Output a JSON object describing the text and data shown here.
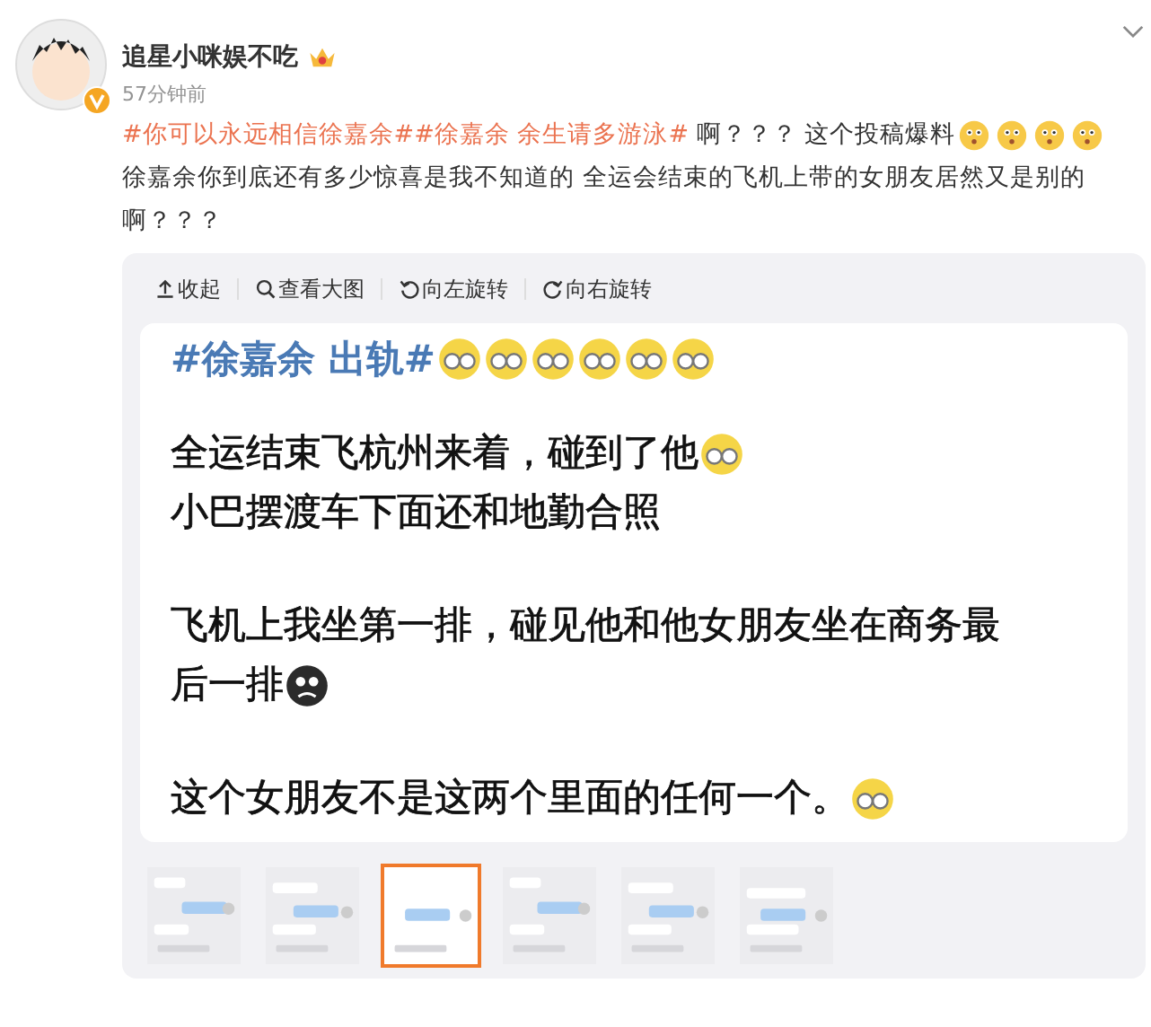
{
  "post": {
    "author": "追星小咪娱不吃",
    "verified": true,
    "time": "57分钟前",
    "lines": [
      [
        {
          "kind": "hashtag",
          "text": "#你可以永远相信徐嘉余#"
        },
        {
          "kind": "hashtag",
          "text": "#徐嘉余 余生请多游泳#"
        },
        {
          "kind": "text",
          "text": " 啊？？？ 这个投稿爆料"
        },
        {
          "kind": "surprised"
        },
        {
          "kind": "surprised"
        },
        {
          "kind": "surprised"
        },
        {
          "kind": "surprised"
        }
      ],
      [
        {
          "kind": "text",
          "text": "徐嘉余你到底还有多少惊喜是我不知道的 全运会结束的飞机上带的女朋友居然又是别的"
        }
      ],
      [
        {
          "kind": "text",
          "text": "啊？？？"
        }
      ]
    ]
  },
  "viewer": {
    "toolbar": [
      {
        "kind": "collapse",
        "label": "收起"
      },
      {
        "kind": "zoom",
        "label": "查看大图"
      },
      {
        "kind": "rotate-left",
        "label": "向左旋转"
      },
      {
        "kind": "rotate-right",
        "label": "向右旋转"
      }
    ],
    "image": {
      "title": [
        {
          "kind": "title",
          "text": "#徐嘉余 出轨#"
        },
        {
          "kind": "glasses"
        },
        {
          "kind": "glasses"
        },
        {
          "kind": "glasses"
        },
        {
          "kind": "glasses"
        },
        {
          "kind": "glasses"
        },
        {
          "kind": "glasses"
        }
      ],
      "paragraphs": [
        [
          [
            {
              "kind": "text",
              "text": "全运结束飞杭州来着，碰到了他"
            },
            {
              "kind": "glasses"
            }
          ],
          [
            {
              "kind": "text",
              "text": "小巴摆渡车下面还和地勤合照"
            }
          ]
        ],
        [
          [
            {
              "kind": "text",
              "text": "飞机上我坐第一排，碰见他和他女朋友坐在商务最"
            }
          ],
          [
            {
              "kind": "text",
              "text": "后一排"
            },
            {
              "kind": "gloomy"
            }
          ]
        ],
        [
          [
            {
              "kind": "text",
              "text": "这个女朋友不是这两个里面的任何一个。"
            },
            {
              "kind": "glasses"
            }
          ]
        ]
      ]
    },
    "thumbnails": [
      {
        "selected": false
      },
      {
        "selected": false
      },
      {
        "selected": true
      },
      {
        "selected": false
      },
      {
        "selected": false
      },
      {
        "selected": false
      }
    ]
  }
}
